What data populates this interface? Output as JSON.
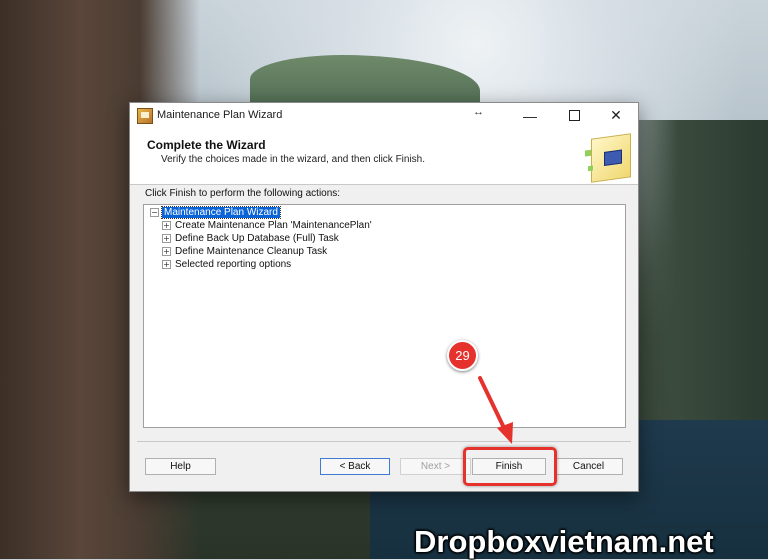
{
  "window": {
    "title": "Maintenance Plan Wizard",
    "resize_glyph": "↔",
    "minimize_glyph": "—",
    "close_glyph": "✕"
  },
  "header": {
    "title": "Complete the Wizard",
    "subtitle": "Verify the choices made in the wizard, and then click Finish."
  },
  "instruction": "Click Finish to perform the following actions:",
  "tree": {
    "root": {
      "label": "Maintenance Plan Wizard",
      "expander": "−"
    },
    "children": [
      {
        "label": "Create Maintenance Plan 'MaintenancePlan'",
        "expander": "+"
      },
      {
        "label": "Define Back Up Database (Full) Task",
        "expander": "+"
      },
      {
        "label": "Define Maintenance Cleanup Task",
        "expander": "+"
      },
      {
        "label": "Selected reporting options",
        "expander": "+"
      }
    ]
  },
  "buttons": {
    "help": "Help",
    "back": "< Back",
    "next": "Next >",
    "finish": "Finish",
    "cancel": "Cancel"
  },
  "annotation": {
    "step_number": "29",
    "color": "#e5322d"
  },
  "watermark": "Dropboxvietnam.net",
  "icons": {
    "app": "wizard-app-icon",
    "header": "wizard-graphic-icon"
  }
}
